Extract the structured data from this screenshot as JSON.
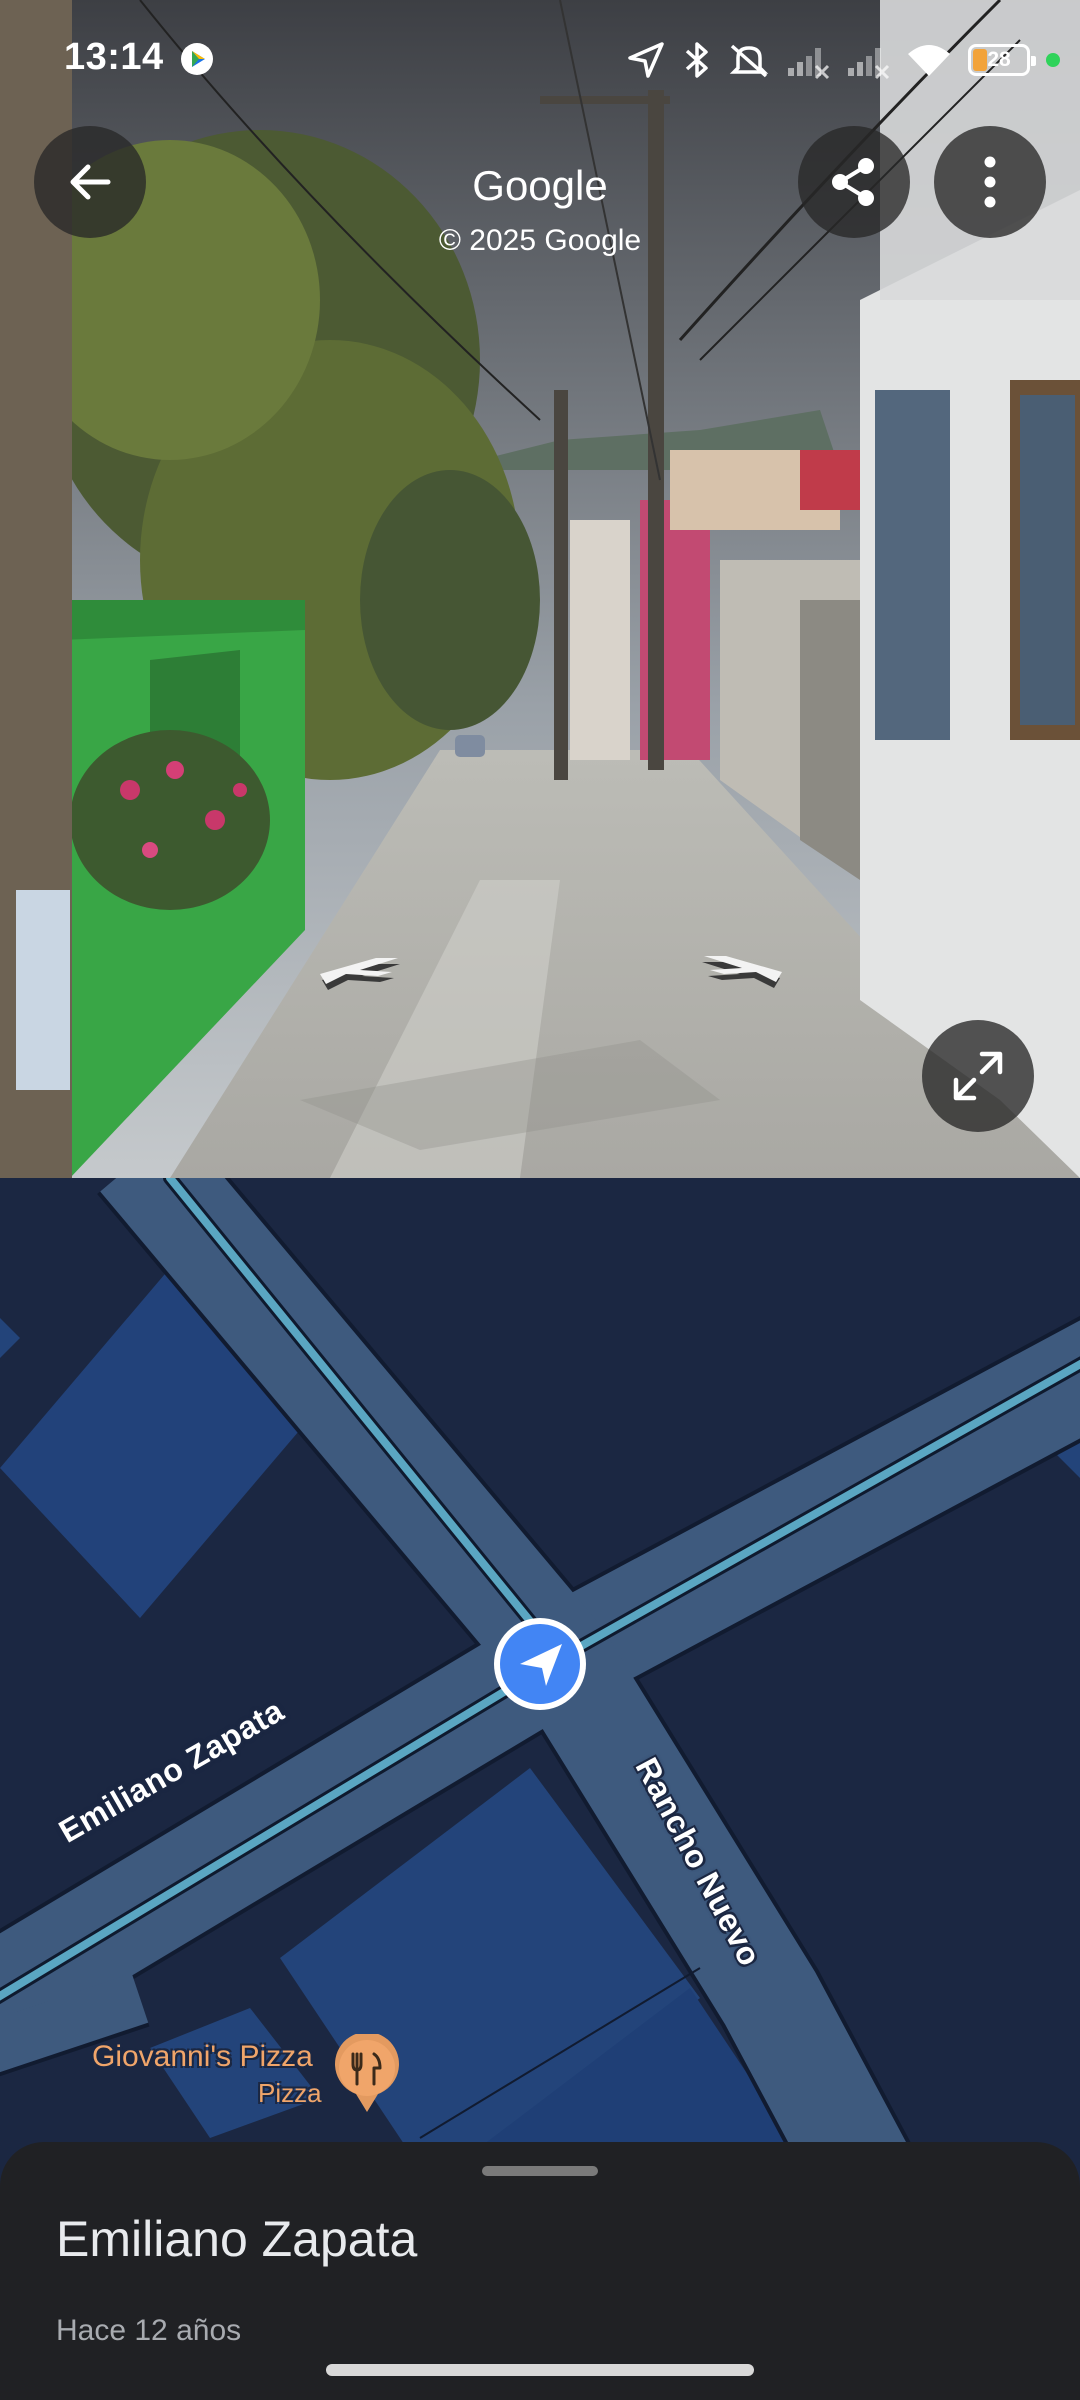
{
  "status_bar": {
    "time": "13:14",
    "battery_level": "28",
    "icons": [
      "google-play-icon",
      "location-arrow-icon",
      "bluetooth-icon",
      "mute-icon",
      "signal-1-icon",
      "signal-2-icon",
      "wifi-icon",
      "battery-icon",
      "privacy-dot-icon"
    ]
  },
  "street_view": {
    "brand": "Google",
    "copyright": "© 2025 Google",
    "buttons": [
      "back-icon",
      "share-icon",
      "more-vert-icon",
      "expand-icon"
    ]
  },
  "map": {
    "roads": [
      {
        "name": "Emiliano Zapata"
      },
      {
        "name": "Rancho Nuevo"
      }
    ],
    "poi": {
      "name": "Giovanni's Pizza",
      "category": "Pizza",
      "icon": "restaurant-icon"
    },
    "colors": {
      "background": "#1b2742",
      "road": "#3e5a7e",
      "highlight": "#5aa6c2",
      "building": "#23447a",
      "location": "#4285f4"
    }
  },
  "sheet": {
    "title": "Emiliano Zapata",
    "subtitle": "Hace 12 años"
  }
}
